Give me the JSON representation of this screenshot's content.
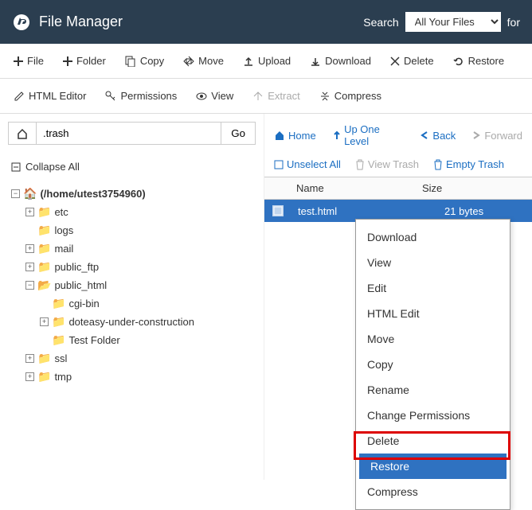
{
  "header": {
    "title": "File Manager",
    "search_label": "Search",
    "search_select": "All Your Files",
    "for_label": "for"
  },
  "toolbar": {
    "file": "File",
    "folder": "Folder",
    "copy": "Copy",
    "move": "Move",
    "upload": "Upload",
    "download": "Download",
    "delete": "Delete",
    "restore": "Restore",
    "html_editor": "HTML Editor",
    "permissions": "Permissions",
    "view": "View",
    "extract": "Extract",
    "compress": "Compress"
  },
  "path": {
    "value": ".trash",
    "go": "Go"
  },
  "collapse_all": "Collapse All",
  "tree": {
    "root": "(/home/utest3754960)",
    "etc": "etc",
    "logs": "logs",
    "mail": "mail",
    "public_ftp": "public_ftp",
    "public_html": "public_html",
    "cgi_bin": "cgi-bin",
    "doteasy": "doteasy-under-construction",
    "test_folder": "Test Folder",
    "ssl": "ssl",
    "tmp": "tmp"
  },
  "crumbs": {
    "home": "Home",
    "up": "Up One Level",
    "back": "Back",
    "forward": "Forward"
  },
  "subbar": {
    "unselect": "Unselect All",
    "view_trash": "View Trash",
    "empty_trash": "Empty Trash"
  },
  "table": {
    "name": "Name",
    "size": "Size"
  },
  "file": {
    "name": "test.html",
    "size": "21 bytes"
  },
  "context": {
    "download": "Download",
    "view": "View",
    "edit": "Edit",
    "html_edit": "HTML Edit",
    "move": "Move",
    "copy": "Copy",
    "rename": "Rename",
    "change_permissions": "Change Permissions",
    "delete": "Delete",
    "restore": "Restore",
    "compress": "Compress"
  }
}
